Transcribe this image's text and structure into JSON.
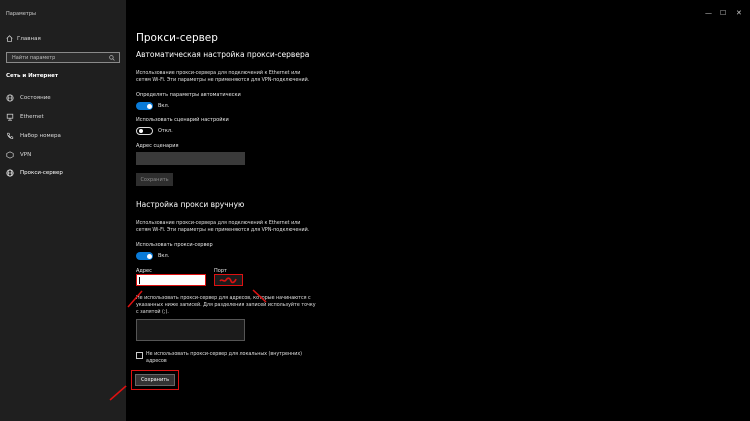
{
  "window": {
    "title": "Параметры",
    "controls": [
      "—",
      "☐",
      "✕"
    ]
  },
  "sidebar": {
    "home_label": "Главная",
    "search_placeholder": "Найти параметр",
    "section_title": "Сеть и Интернет",
    "items": [
      {
        "label": "Состояние",
        "icon": "globe-icon"
      },
      {
        "label": "Ethernet",
        "icon": "ethernet-icon"
      },
      {
        "label": "Набор номера",
        "icon": "phone-icon"
      },
      {
        "label": "VPN",
        "icon": "vpn-icon"
      },
      {
        "label": "Прокси-сервер",
        "icon": "globe-icon"
      }
    ],
    "active_item": "Прокси-сервер"
  },
  "main": {
    "title": "Прокси-сервер",
    "auto": {
      "heading": "Автоматическая настройка прокси-сервера",
      "desc_line1": "Использование прокси-сервера для подключений к Ethernet или",
      "desc_line2": "сетям Wi-Fi. Эти параметры не применяются для VPN-подключений.",
      "detect_label": "Определять параметры автоматически",
      "detect_state": "Вкл.",
      "script_label": "Использовать сценарий настройки",
      "script_state": "Откл.",
      "address_label": "Адрес сценария",
      "save_label": "Сохранить"
    },
    "manual": {
      "heading": "Настройка прокси вручную",
      "desc_line1": "Использование прокси-сервера для подключений к Ethernet или",
      "desc_line2": "сетям Wi-Fi. Эти параметры не применяются для VPN-подключений.",
      "use_label": "Использовать прокси-сервер",
      "use_state": "Вкл.",
      "address_label": "Адрес",
      "port_label": "Порт",
      "exceptions_line1": "Не использовать прокси-сервер для адресов, которые начинаются с",
      "exceptions_line2": "указанных ниже записей. Для разделения записей используйте точку",
      "exceptions_line3": "с запятой (;).",
      "local_line1": "Не использовать прокси-сервер для локальных (внутренних)",
      "local_line2": "адресов",
      "save_label": "Сохранить"
    }
  },
  "colors": {
    "accent": "#0a7bd8",
    "highlight": "#dd1111"
  }
}
